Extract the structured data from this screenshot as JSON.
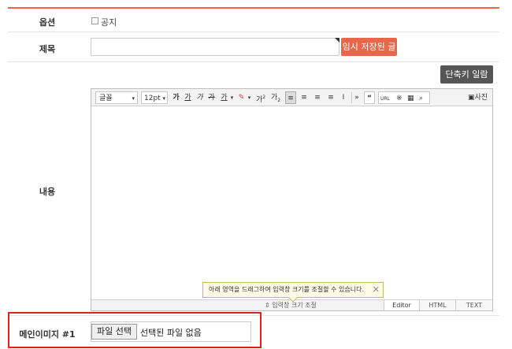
{
  "form": {
    "option_label": "옵션",
    "notice_label": "공지",
    "title_label": "제목",
    "draft_button": "임시 저장된 글",
    "content_label": "내용",
    "shortcut_button": "단축키 일람",
    "main_image_label": "메인이미지 #1",
    "file_button": "파일 선택",
    "file_status": "선택된 파일 없음"
  },
  "editor": {
    "font_select": "글꼴",
    "size_select": "12pt",
    "format_buttons": [
      "가",
      "가",
      "가",
      "가",
      "가"
    ],
    "superscript": "가",
    "subscript": "가",
    "more": "»",
    "quote": "“",
    "url": "URL",
    "photo_button": "사진",
    "resize_label": "입력창 크기 조절",
    "tooltip": "아래 영역을 드래그하여 입력창 크기를 조절할 수 있습니다.",
    "tooltip_close": "✕",
    "modes": [
      "Editor",
      "HTML",
      "TEXT"
    ]
  },
  "colors": {
    "accent": "#e8664a",
    "dark_button": "#555555",
    "highlight_border": "#e02020"
  },
  "icons": [
    "checkbox",
    "chevron-down-icon",
    "align-left-icon",
    "align-center-icon",
    "align-right-icon",
    "align-justify-icon",
    "line-height-icon",
    "special-char-icon",
    "table-icon",
    "search-icon",
    "photo-icon",
    "close-icon",
    "resize-icon"
  ]
}
